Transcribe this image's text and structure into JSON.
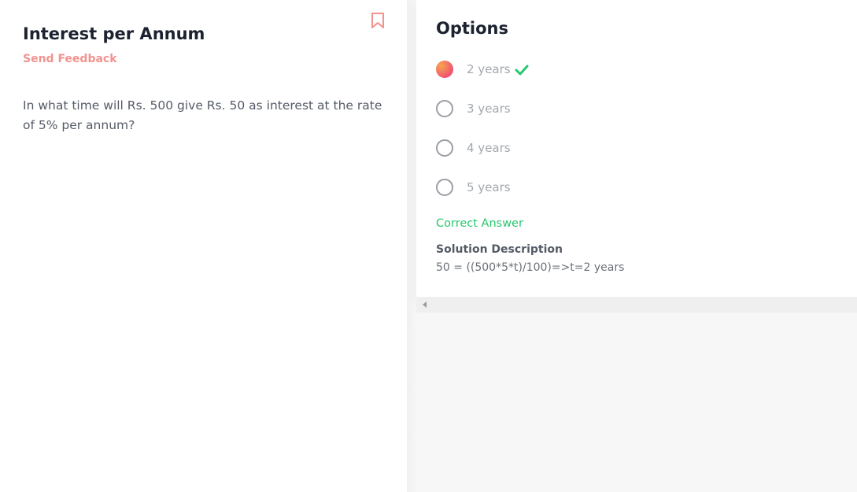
{
  "question_panel": {
    "title": "Interest per Annum",
    "feedback_label": "Send Feedback",
    "question_text": "In what time will Rs. 500 give Rs. 50 as interest at the rate of 5% per annum?"
  },
  "options_panel": {
    "heading": "Options",
    "options": [
      {
        "label": "2 years",
        "selected": true,
        "correct": true
      },
      {
        "label": "3 years",
        "selected": false,
        "correct": false
      },
      {
        "label": "4 years",
        "selected": false,
        "correct": false
      },
      {
        "label": "5 years",
        "selected": false,
        "correct": false
      }
    ],
    "result_label": "Correct Answer",
    "solution_title": "Solution Description",
    "solution_text": "50 = ((500*5*t)/100)=>t=2 years"
  },
  "icons": {
    "bookmark": "bookmark-icon",
    "check": "check-icon",
    "scroll_left": "scroll-left-arrow-icon"
  },
  "colors": {
    "accent_pink": "#f2938f",
    "correct_green": "#28c76f",
    "selected_gradient_start": "#f7a54e",
    "selected_gradient_end": "#f04e73"
  }
}
